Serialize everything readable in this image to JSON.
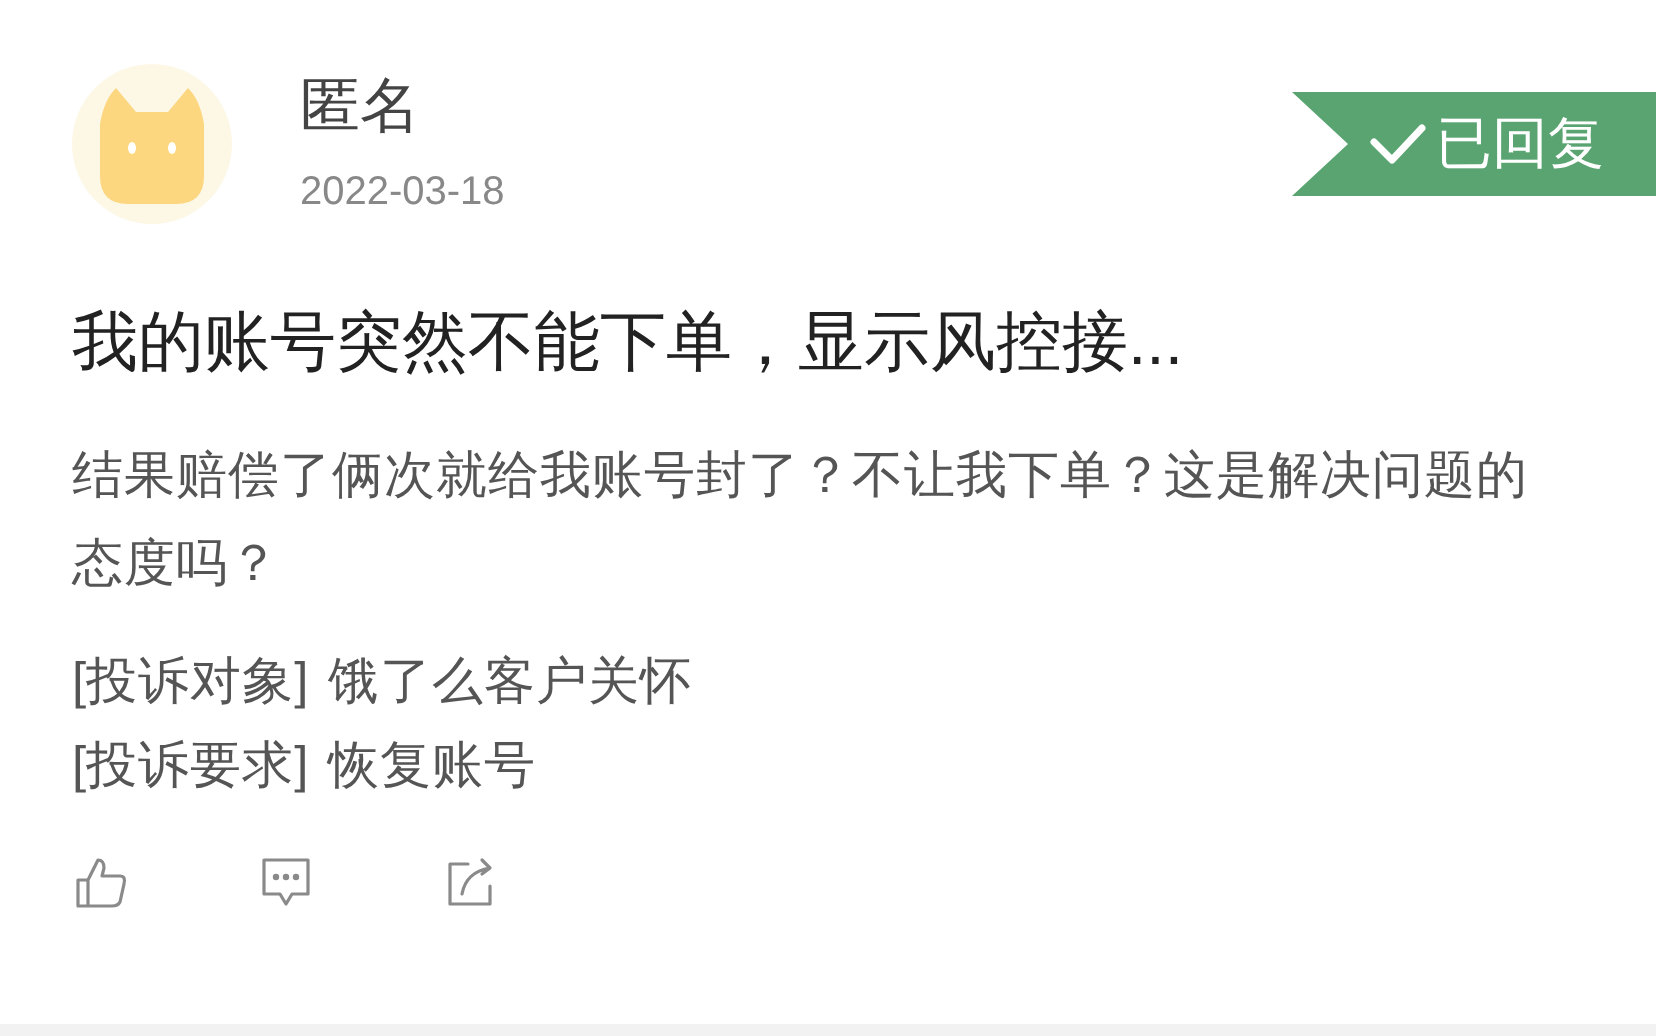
{
  "author": {
    "name": "匿名",
    "date": "2022-03-18"
  },
  "status": {
    "kind": "replied",
    "label": "已回复"
  },
  "title": "我的账号突然不能下单，显示风控接...",
  "body": "结果赔偿了俩次就给我账号封了？不让我下单？这是解决问题的态度吗？",
  "details": [
    {
      "label": "[投诉对象]",
      "value": "饿了么客户关怀"
    },
    {
      "label": "[投诉要求]",
      "value": "恢复账号"
    }
  ],
  "actions": [
    {
      "kind": "like"
    },
    {
      "kind": "comment"
    },
    {
      "kind": "share"
    }
  ]
}
